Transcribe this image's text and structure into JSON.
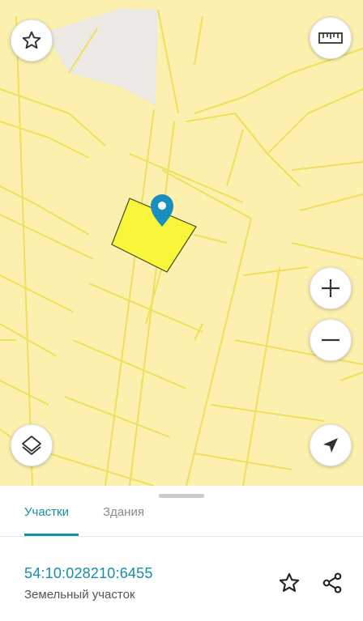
{
  "map": {
    "background_color": "#fbf0ae",
    "parcel_line_color": "#f0df5c",
    "selected_parcel_color": "#f8f53a",
    "marker_color": "#1b8ec0",
    "buttons": {
      "favorite": "star-icon",
      "ruler": "ruler-icon",
      "zoom_in": "plus-icon",
      "zoom_out": "minus-icon",
      "layers": "layers-icon",
      "locate": "navigation-arrow-icon"
    }
  },
  "tabs": [
    {
      "label": "Участки",
      "active": true
    },
    {
      "label": "Здания",
      "active": false
    }
  ],
  "parcel": {
    "cadastral_number": "54:10:028210:6455",
    "type": "Земельный участок"
  },
  "actions": {
    "favorite": "star-outline-icon",
    "share": "share-icon"
  },
  "accent_color": "#158ea7"
}
